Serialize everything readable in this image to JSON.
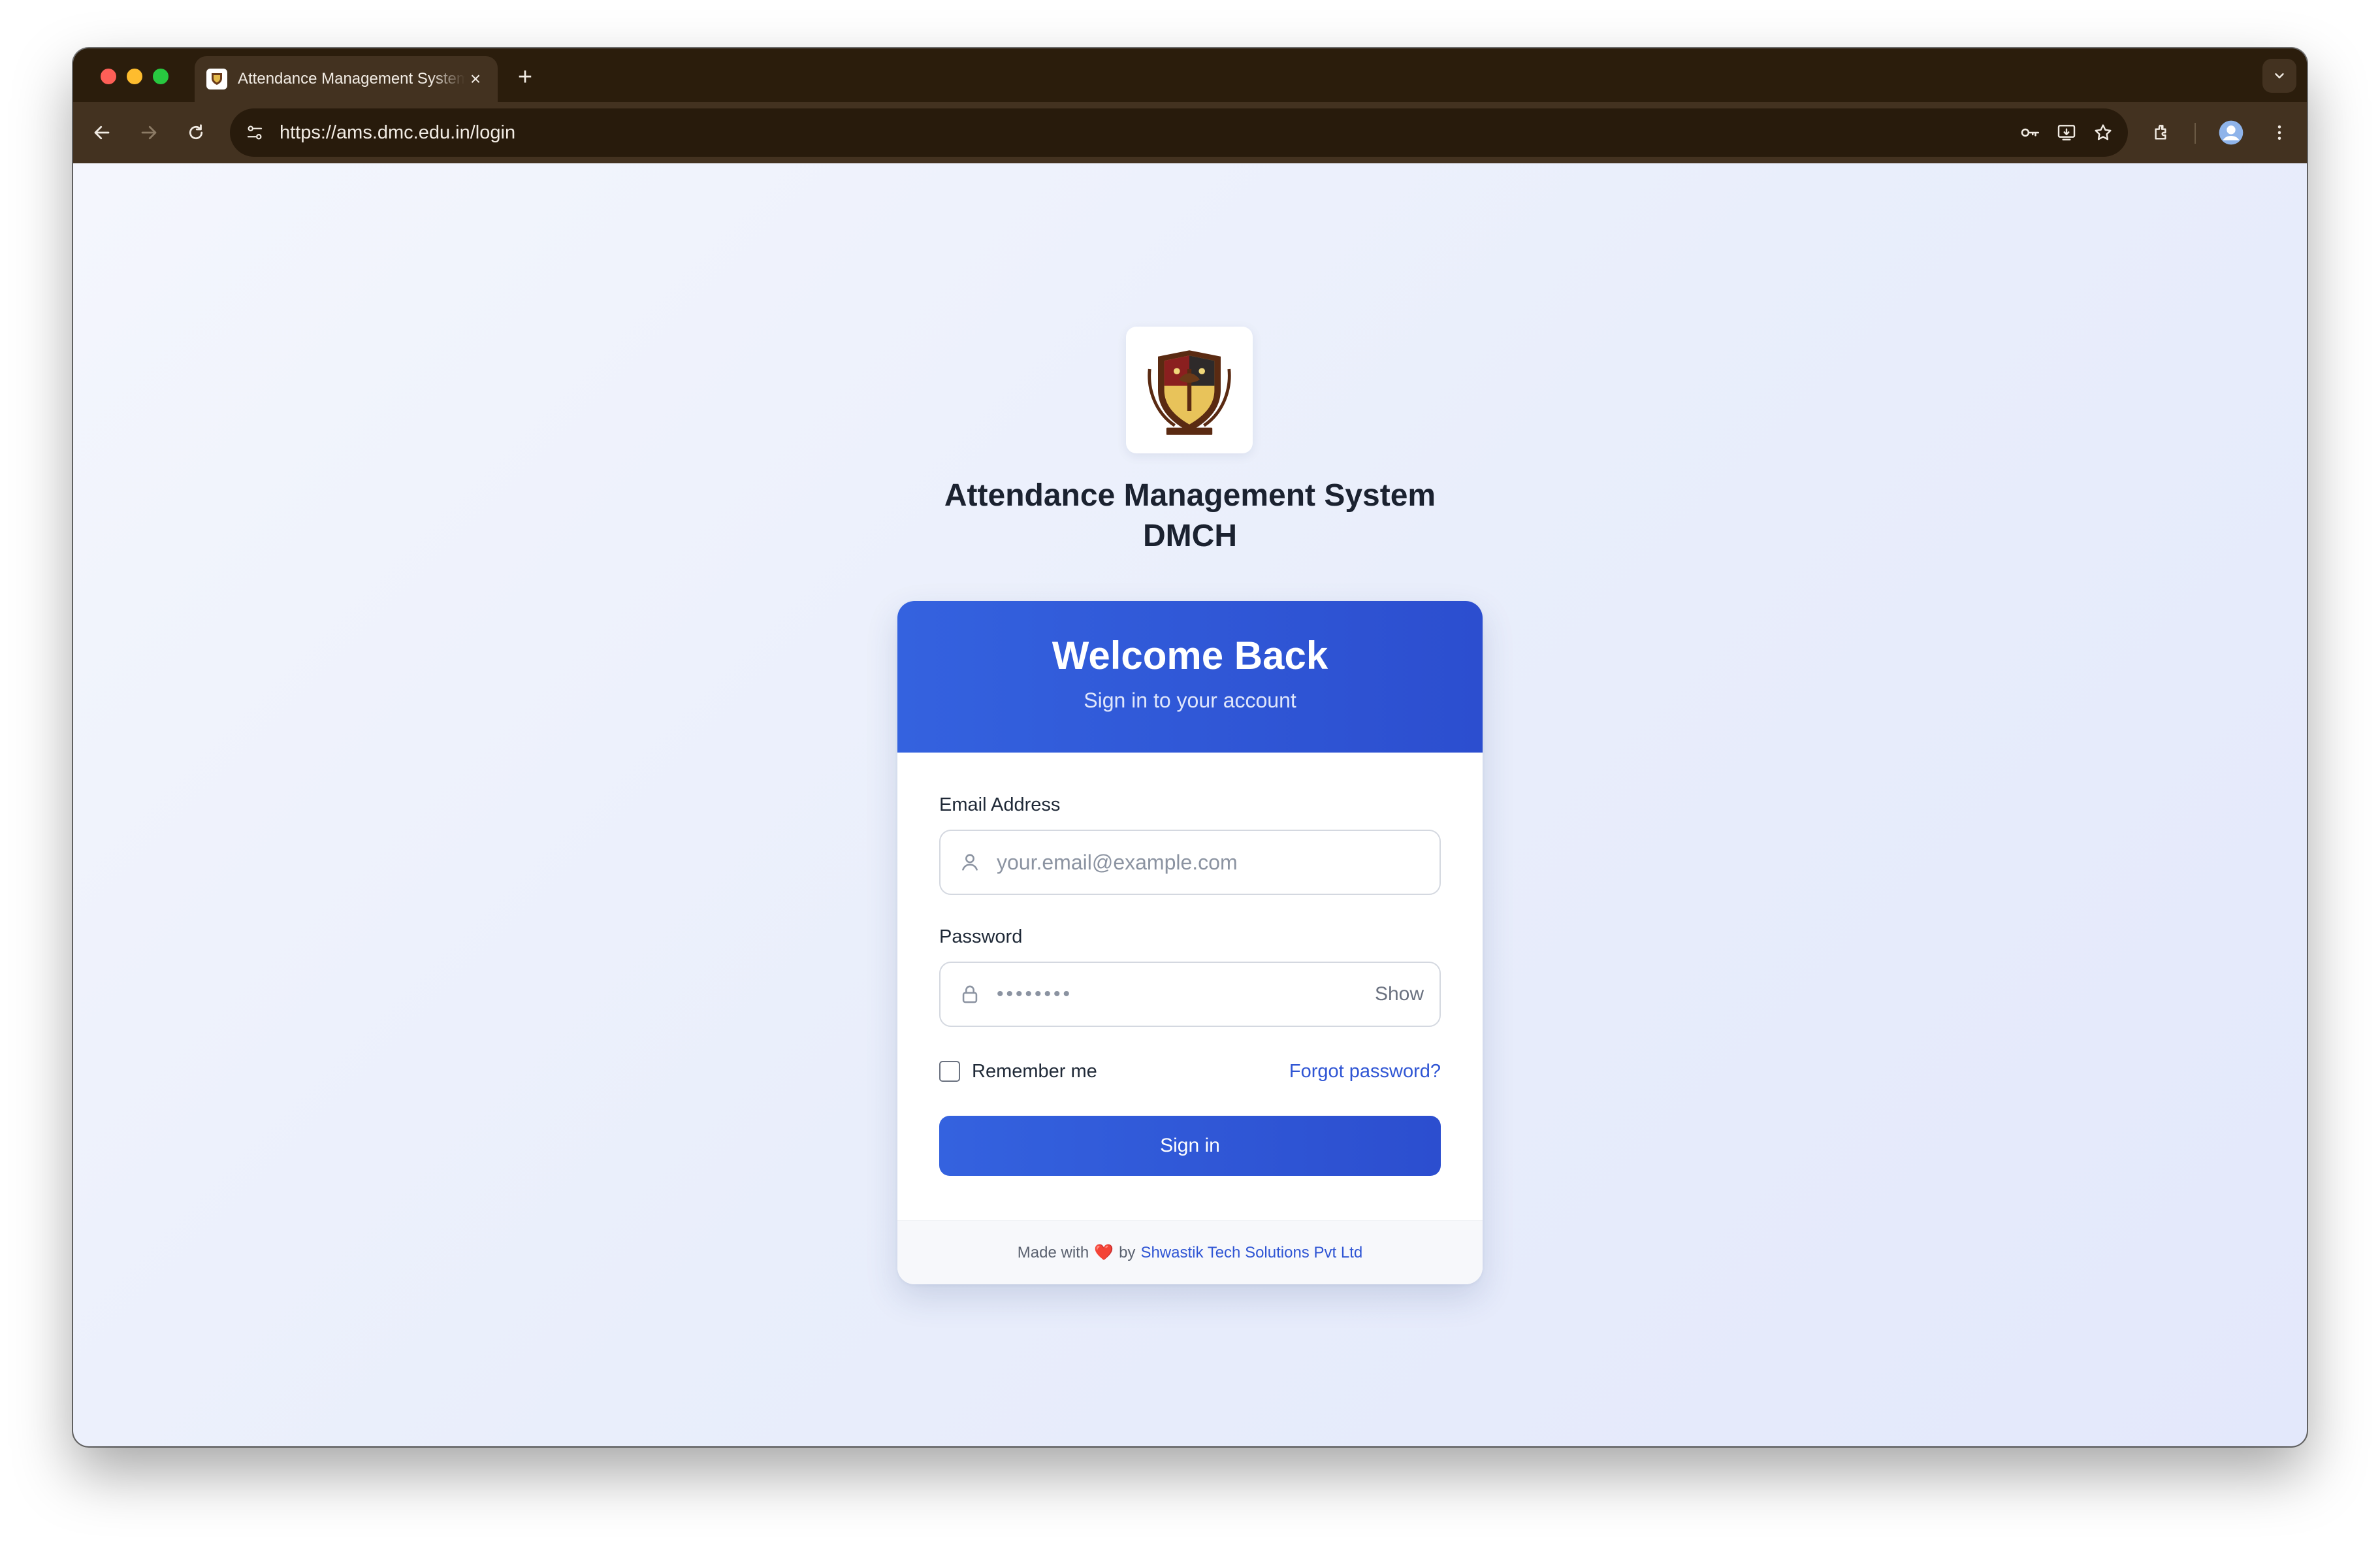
{
  "browser": {
    "tab_title": "Attendance Management System DMCH",
    "url": "https://ams.dmc.edu.in/login",
    "icons": [
      "back-icon",
      "forward-icon",
      "reload-icon",
      "site-settings-icon",
      "password-key-icon",
      "install-app-icon",
      "bookmark-star-icon",
      "extensions-icon",
      "profile-avatar",
      "more-menu-icon",
      "tab-close-icon",
      "new-tab-icon",
      "tab-list-chevron-icon"
    ]
  },
  "header": {
    "title_line1": "Attendance Management System",
    "title_line2": "DMCH"
  },
  "card": {
    "heading": "Welcome Back",
    "subheading": "Sign in to your account",
    "email_label": "Email Address",
    "email_placeholder": "your.email@example.com",
    "password_label": "Password",
    "password_value": "••••••••",
    "show_label": "Show",
    "remember_label": "Remember me",
    "remember_checked": false,
    "forgot_label": "Forgot password?",
    "signin_label": "Sign in"
  },
  "footer": {
    "made_with": "Made with",
    "heart": "❤️",
    "by": "by",
    "company": "Shwastik Tech Solutions Pvt Ltd"
  },
  "colors": {
    "primary": "#3462df",
    "browser_frame": "#2b1d0c",
    "link": "#2f55d4"
  }
}
